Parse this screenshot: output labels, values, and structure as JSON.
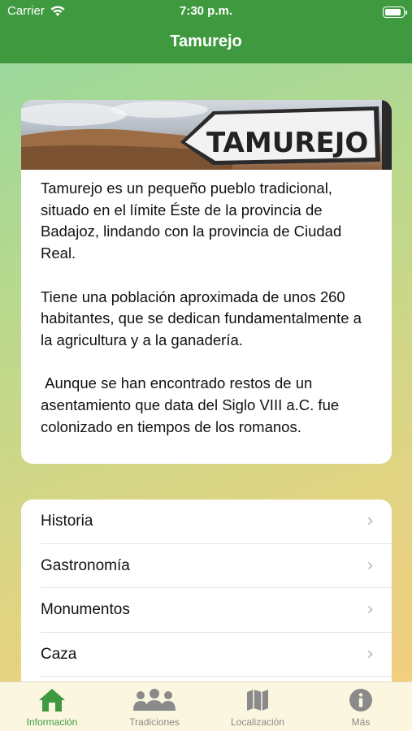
{
  "status": {
    "carrier": "Carrier",
    "time": "7:30 p.m."
  },
  "nav": {
    "title": "Tamurejo"
  },
  "card": {
    "sign_text": "TAMUREJO",
    "description": "Tamurejo es un pequeño pueblo tradicional, situado en el límite Éste de la provincia de Badajoz, lindando con la provincia de Ciudad Real.\n\nTiene una población aproximada de unos 260 habitantes, que se dedican fundamentalmente a la agricultura y a la ganadería.\n\n Aunque se han encontrado restos de un asentamiento que data del Siglo VIII a.C. fue colonizado en tiempos de los romanos."
  },
  "menu": {
    "items": [
      {
        "label": "Historia"
      },
      {
        "label": "Gastronomía"
      },
      {
        "label": "Monumentos"
      },
      {
        "label": "Caza"
      }
    ]
  },
  "tabs": [
    {
      "label": "Información",
      "icon": "house-icon",
      "active": true
    },
    {
      "label": "Tradiciones",
      "icon": "people-icon",
      "active": false
    },
    {
      "label": "Localización",
      "icon": "map-icon",
      "active": false
    },
    {
      "label": "Más",
      "icon": "info-icon",
      "active": false
    }
  ],
  "colors": {
    "nav": "#3f9a3f",
    "active_tab": "#3f9a3f",
    "inactive_tab": "#8a8a8a"
  }
}
